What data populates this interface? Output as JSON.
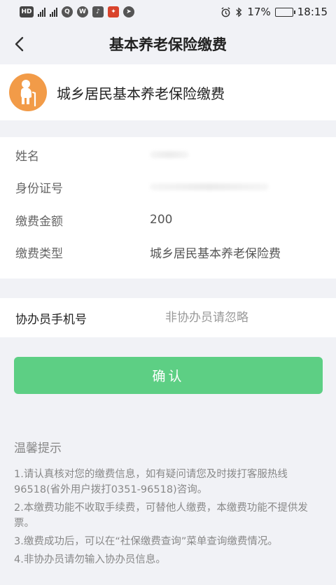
{
  "statusbar": {
    "battery_percent": "17%",
    "time": "18:15",
    "battery_level": 0.17,
    "icons": [
      "hd-icon",
      "4g-signal-icon",
      "signal-icon",
      "qq-icon",
      "wechat-icon",
      "notification-icon",
      "app-icon",
      "alarm-icon",
      "bluetooth-icon",
      "battery-icon"
    ]
  },
  "nav": {
    "title": "基本养老保险缴费"
  },
  "header": {
    "title": "城乡居民基本养老保险缴费",
    "avatar_color": "#f29b48"
  },
  "info": {
    "rows": [
      {
        "label": "姓名",
        "value": ""
      },
      {
        "label": "身份证号",
        "value": ""
      },
      {
        "label": "缴费金额",
        "value": "200"
      },
      {
        "label": "缴费类型",
        "value": "城乡居民基本养老保险费"
      }
    ]
  },
  "assist": {
    "label": "协办员手机号",
    "placeholder": "非协办员请忽略"
  },
  "confirm_button": {
    "label": "确认",
    "color": "#5dcf84"
  },
  "tips": {
    "title": "温馨提示",
    "items": [
      "1.请认真核对您的缴费信息，如有疑问请您及时拨打客服热线96518(省外用户拨打0351-96518)咨询。",
      "2.本缴费功能不收取手续费，可替他人缴费，本缴费功能不提供发票。",
      "3.缴费成功后，可以在“社保缴费查询”菜单查询缴费情况。",
      "4.非协办员请勿输入协办员信息。"
    ]
  }
}
